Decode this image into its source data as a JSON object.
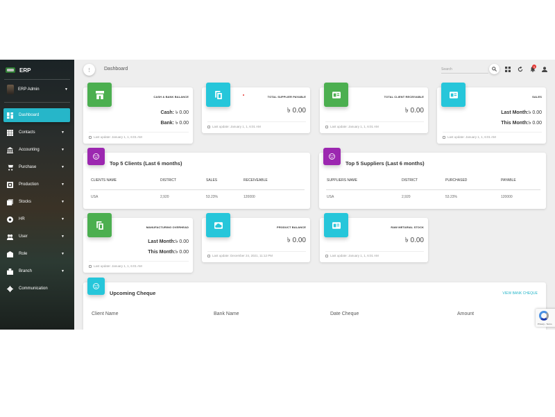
{
  "app": {
    "title": "ERP"
  },
  "sidebar": {
    "user": "ERP Admin",
    "items": [
      {
        "label": "Dashboard",
        "icon": "dashboard-icon",
        "active": true
      },
      {
        "label": "Contacts",
        "icon": "grid-icon"
      },
      {
        "label": "Accounting",
        "icon": "bank-icon"
      },
      {
        "label": "Purchase",
        "icon": "cart-icon"
      },
      {
        "label": "Production",
        "icon": "production-icon"
      },
      {
        "label": "Stocks",
        "icon": "stocks-icon"
      },
      {
        "label": "HR",
        "icon": "hr-icon"
      },
      {
        "label": "User",
        "icon": "users-icon"
      },
      {
        "label": "Role",
        "icon": "role-icon"
      },
      {
        "label": "Branch",
        "icon": "branch-icon"
      },
      {
        "label": "Communication",
        "icon": "gear-icon"
      }
    ]
  },
  "header": {
    "page_title": "Dashboard",
    "search_placeholder": "Search",
    "notification_count": "5"
  },
  "cards": {
    "cash_bank": {
      "title": "CASH & BANK BALANCE",
      "cash_label": "Cash:",
      "cash_value": "৳ 0.00",
      "bank_label": "Bank:",
      "bank_value": "৳ 0.00",
      "updated": "Last update: January 1, 1, 6:01 AM"
    },
    "supplier_payable": {
      "title": "TOTAL SUPPLIER PAYABLE",
      "value": "৳ 0.00",
      "updated": "Last update: January 1, 1, 6:01 AM"
    },
    "client_receivable": {
      "title": "TOTAL CLIENT RECEIVABLE",
      "value": "৳ 0.00",
      "updated": "Last update: January 1, 1, 6:01 AM"
    },
    "sales": {
      "title": "SALES",
      "last_label": "Last Month:",
      "last_value": "৳ 0.00",
      "this_label": "This Month:",
      "this_value": "৳ 0.00",
      "updated": "Last update: January 1, 1, 6:01 AM"
    },
    "manufacturing": {
      "title": "MANUFACTURING OVERHEAD",
      "last_label": "Last Month:",
      "last_value": "৳ 0.00",
      "this_label": "This Month:",
      "this_value": "৳ 0.00",
      "updated": "Last update: January 1, 1, 6:01 AM"
    },
    "product_balance": {
      "title": "PRODUCT BALANCE",
      "value": "৳ 0.00",
      "updated": "Last update: December 24, 2021, 11:12 PM"
    },
    "raw_material": {
      "title": "RAW METARIAL STOCK",
      "value": "৳ 0.00",
      "updated": "Last update: January 1, 1, 6:01 AM"
    }
  },
  "top_clients": {
    "title": "Top 5 Clients (Last 6 months)",
    "columns": [
      "CLIENTS NAME",
      "DISTRICT",
      "SALES",
      "RECEIVEABLE"
    ],
    "rows": [
      [
        "USA",
        "2,920",
        "53.23%",
        "120000"
      ]
    ]
  },
  "top_suppliers": {
    "title": "Top 5 Suppliers (Last 6 months)",
    "columns": [
      "SUPPLIERS NAME",
      "DISTRICT",
      "PURCHASED",
      "PAYABLE"
    ],
    "rows": [
      [
        "USA",
        "2,920",
        "53.23%",
        "120000"
      ]
    ]
  },
  "cheque": {
    "title": "Upcoming Cheque",
    "link": "VIEW BANK CHEQUE",
    "columns": [
      "Client Name",
      "Bank Name",
      "Date Cheque",
      "Amount"
    ]
  },
  "recaptcha": {
    "text": "Privacy - Terms"
  },
  "colors": {
    "accent": "#26b6c9",
    "green": "#4caf50",
    "cyan": "#26c6da",
    "purple": "#9c27b0",
    "badge": "#e53935"
  }
}
